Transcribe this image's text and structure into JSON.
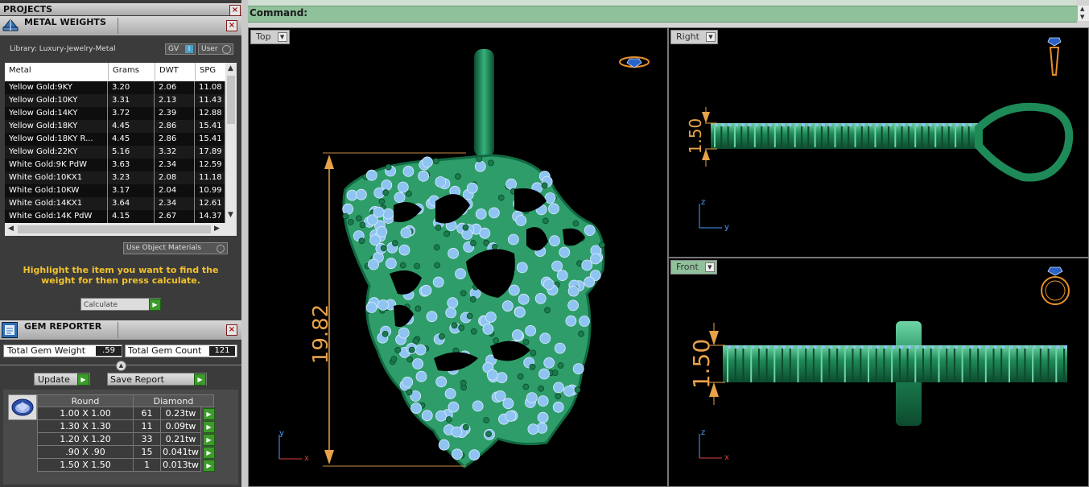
{
  "projects": {
    "title": "PROJECTS"
  },
  "metal_weights": {
    "title": "METAL WEIGHTS",
    "library": "Library: Luxury-Jewelry-Metal",
    "gv_label": "GV",
    "user_label": "User",
    "headers": [
      "Metal",
      "Grams",
      "DWT",
      "SPG"
    ],
    "rows": [
      [
        "Yellow Gold:9KY",
        "3.20",
        "2.06",
        "11.08"
      ],
      [
        "Yellow Gold:10KY",
        "3.31",
        "2.13",
        "11.43"
      ],
      [
        "Yellow Gold:14KY",
        "3.72",
        "2.39",
        "12.88"
      ],
      [
        "Yellow Gold:18KY",
        "4.45",
        "2.86",
        "15.41"
      ],
      [
        "Yellow Gold:18KY R...",
        "4.45",
        "2.86",
        "15.41"
      ],
      [
        "Yellow Gold:22KY",
        "5.16",
        "3.32",
        "17.89"
      ],
      [
        "White Gold:9K PdW",
        "3.63",
        "2.34",
        "12.59"
      ],
      [
        "White Gold:10KX1",
        "3.23",
        "2.08",
        "11.18"
      ],
      [
        "White Gold:10KW",
        "3.17",
        "2.04",
        "10.99"
      ],
      [
        "White Gold:14KX1",
        "3.64",
        "2.34",
        "12.61"
      ],
      [
        "White Gold:14K PdW",
        "4.15",
        "2.67",
        "14.37"
      ]
    ],
    "use_object_materials": "Use Object Materials",
    "instruction": "Highlight the item you want to find the weight for then press calculate.",
    "calculate_label": "Calculate"
  },
  "gem_reporter": {
    "title": "GEM REPORTER",
    "total_weight_label": "Total Gem Weight",
    "total_weight_value": ".59",
    "total_count_label": "Total Gem Count",
    "total_count_value": "121",
    "update_label": "Update",
    "save_report_label": "Save Report",
    "col_shape": "Round",
    "col_type": "Diamond",
    "rows": [
      [
        "1.00 X 1.00",
        "61",
        "0.23tw"
      ],
      [
        "1.30 X 1.30",
        "11",
        "0.09tw"
      ],
      [
        "1.20 X 1.20",
        "33",
        "0.21tw"
      ],
      [
        ".90 X .90",
        "15",
        "0.041tw"
      ],
      [
        "1.50 X 1.50",
        "1",
        "0.013tw"
      ]
    ]
  },
  "command": {
    "label": "Command:"
  },
  "viewports": {
    "top": {
      "label": "Top",
      "dimension": "19.82",
      "axis_y": "y",
      "axis_x": "x"
    },
    "right": {
      "label": "Right",
      "dimension": "1.50",
      "axis_y": "z",
      "axis_x": "y"
    },
    "front": {
      "label": "Front",
      "dimension": "1.50",
      "axis_y": "z",
      "axis_x": "x"
    }
  },
  "colors": {
    "metal": "#1f8a5a",
    "gem": "#8fc4f2",
    "dimension": "#e8a24a",
    "command_bar": "#8fc19a",
    "instruction": "#f2c230"
  }
}
